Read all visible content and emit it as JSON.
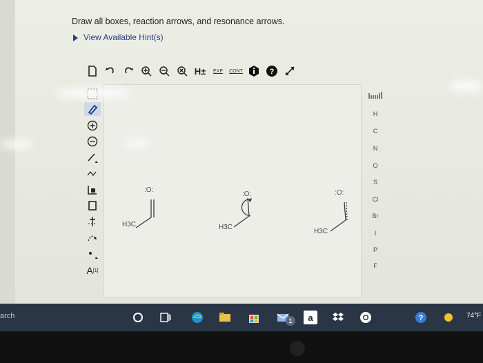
{
  "question": {
    "instructions": "Draw all boxes, reaction arrows, and resonance arrows.",
    "hint_link": "View Available Hint(s)"
  },
  "toolbar": {
    "items": [
      "new-doc-icon",
      "undo-icon",
      "redo-icon",
      "zoom-in-icon",
      "zoom-out-icon",
      "clear-icon"
    ],
    "h_label": "H±",
    "exp_label": "EXP",
    "cont_label": "CONT",
    "info_icon": "info-icon",
    "help_icon": "help-icon",
    "fullscreen_icon": "expand-icon"
  },
  "left_tools": {
    "atom_label": "A",
    "atom_superscript": "[1]"
  },
  "elements_panel": {
    "header_icon": "periodic-table-icon",
    "items": [
      "H",
      "C",
      "N",
      "O",
      "S",
      "Cl",
      "Br",
      "I",
      "P",
      "F"
    ]
  },
  "molecules": [
    {
      "label": "H3C",
      "carbonyl_o": ":O:"
    },
    {
      "label": "H3C",
      "carbonyl_o": ":O:"
    },
    {
      "label": "H3C",
      "carbonyl_o": ":O:"
    }
  ],
  "taskbar": {
    "search_fragment": "arch",
    "badge_count": "1",
    "amazon_label": "a",
    "weather": "74°F"
  }
}
